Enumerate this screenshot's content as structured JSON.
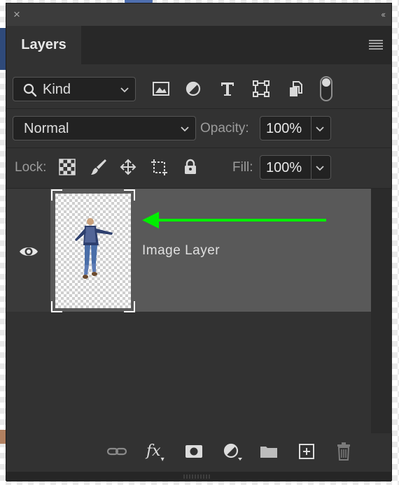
{
  "panel": {
    "title": "Layers",
    "close_glyph": "×",
    "collapse_glyph": "‹‹"
  },
  "filter": {
    "kind_label": "Kind",
    "icons": [
      "image-filter-icon",
      "adjustment-filter-icon",
      "type-filter-icon",
      "shape-filter-icon",
      "smart-object-filter-icon"
    ]
  },
  "blend": {
    "mode": "Normal",
    "opacity_label": "Opacity:",
    "opacity_value": "100%"
  },
  "lock": {
    "label": "Lock:",
    "icons": [
      "lock-transparent-pixels-icon",
      "lock-image-pixels-icon",
      "lock-position-icon",
      "prevent-auto-nesting-icon",
      "lock-all-icon"
    ],
    "fill_label": "Fill:",
    "fill_value": "100%"
  },
  "layers": [
    {
      "name": "Image Layer",
      "visible": true,
      "selected": true
    }
  ],
  "footer": {
    "icons": [
      "link-layers-icon",
      "fx-icon",
      "add-mask-icon",
      "new-fill-adjustment-icon",
      "new-group-icon",
      "new-layer-icon",
      "delete-layer-icon"
    ],
    "fx_label": "fx"
  },
  "colors": {
    "panel": "#323232",
    "selected_row": "#595959",
    "annotation_arrow": "#00ee00"
  }
}
